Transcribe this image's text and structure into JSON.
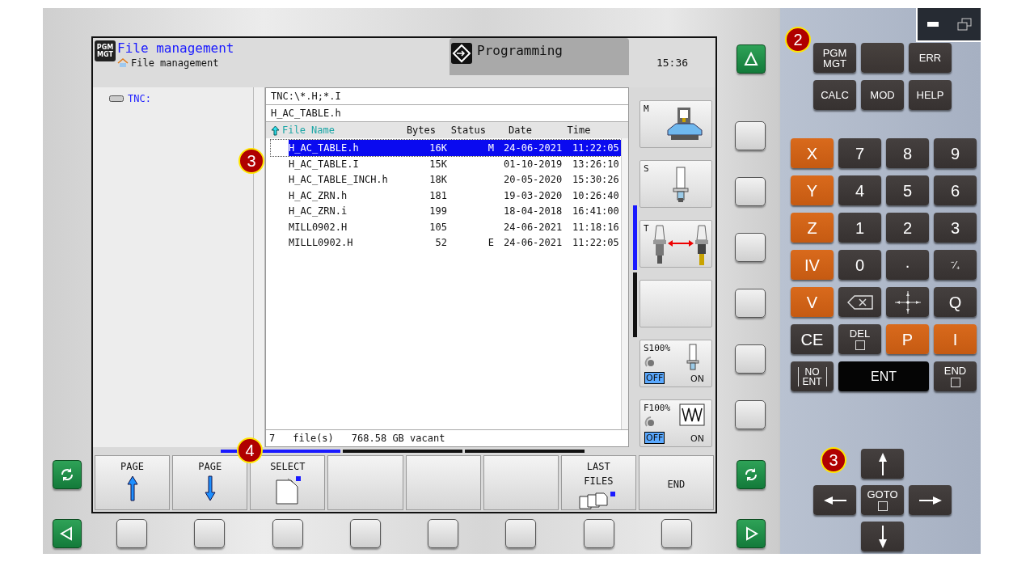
{
  "header": {
    "app_icon": "PGM MGT",
    "title": "File management",
    "breadcrumb": "File management",
    "mode_tab": "Programming",
    "clock": "15:36"
  },
  "tree": [
    {
      "label": "TNC:",
      "selected": false
    }
  ],
  "file_filter": "TNC:\\*.H;*.I",
  "current_file": "H_AC_TABLE.h",
  "columns": [
    "File Name",
    "Bytes",
    "Status",
    "Date",
    "Time"
  ],
  "rows": [
    {
      "name": "H_AC_TABLE.h",
      "bytes": "16K",
      "status": "M",
      "date": "24-06-2021",
      "time": "11:22:05",
      "selected": true
    },
    {
      "name": "H_AC_TABLE.I",
      "bytes": "15K",
      "status": "",
      "date": "01-10-2019",
      "time": "13:26:10",
      "selected": false
    },
    {
      "name": "H_AC_TABLE_INCH.h",
      "bytes": "18K",
      "status": "",
      "date": "20-05-2020",
      "time": "15:30:26",
      "selected": false
    },
    {
      "name": "H_AC_ZRN.h",
      "bytes": "181",
      "status": "",
      "date": "19-03-2020",
      "time": "10:26:40",
      "selected": false
    },
    {
      "name": "H_AC_ZRN.i",
      "bytes": "199",
      "status": "",
      "date": "18-04-2018",
      "time": "16:41:00",
      "selected": false
    },
    {
      "name": "MILL0902.H",
      "bytes": "105",
      "status": "",
      "date": "24-06-2021",
      "time": "11:18:16",
      "selected": false
    },
    {
      "name": "MILLL0902.H",
      "bytes": "52",
      "status": "E",
      "date": "24-06-2021",
      "time": "11:22:05",
      "selected": false
    }
  ],
  "rows_callout": "3",
  "status_bar": {
    "count": "7",
    "unit": "file(s)",
    "free": "768.58 GB vacant"
  },
  "side_softkeys": [
    {
      "kind": "machine",
      "label": "M"
    },
    {
      "kind": "spindle",
      "label": "S"
    },
    {
      "kind": "tool-change",
      "label": "T"
    },
    {
      "kind": "blank"
    },
    {
      "kind": "spindle-override",
      "label": "S100%",
      "off": "OFF",
      "on": "ON"
    },
    {
      "kind": "feed-override",
      "label": "F100%",
      "off": "OFF",
      "on": "ON"
    }
  ],
  "softkey_pages": [
    {
      "selected": true
    },
    {
      "selected": false
    },
    {
      "selected": false
    }
  ],
  "softkeys_callout": "4",
  "softkeys": [
    {
      "kind": "page-up",
      "label": "PAGE"
    },
    {
      "kind": "page-down",
      "label": "PAGE"
    },
    {
      "kind": "select",
      "label": "SELECT"
    },
    {
      "kind": "blank"
    },
    {
      "kind": "blank"
    },
    {
      "kind": "blank"
    },
    {
      "kind": "last-files",
      "label": "LAST FILES"
    },
    {
      "kind": "text",
      "label": "END"
    }
  ],
  "keypad_callout": "2",
  "function_keys": [
    {
      "kind": "text",
      "label": "PGM MGT"
    },
    {
      "kind": "blank"
    },
    {
      "kind": "text",
      "label": "ERR"
    },
    {
      "kind": "text",
      "label": "CALC"
    },
    {
      "kind": "text",
      "label": "MOD"
    },
    {
      "kind": "text",
      "label": "HELP"
    }
  ],
  "keypad": [
    {
      "kind": "axis",
      "label": "X"
    },
    {
      "kind": "text",
      "label": "7"
    },
    {
      "kind": "text",
      "label": "8"
    },
    {
      "kind": "text",
      "label": "9"
    },
    {
      "kind": "axis",
      "label": "Y"
    },
    {
      "kind": "text",
      "label": "4"
    },
    {
      "kind": "text",
      "label": "5"
    },
    {
      "kind": "text",
      "label": "6"
    },
    {
      "kind": "axis",
      "label": "Z"
    },
    {
      "kind": "text",
      "label": "1"
    },
    {
      "kind": "text",
      "label": "2"
    },
    {
      "kind": "text",
      "label": "3"
    },
    {
      "kind": "axis",
      "label": "IV"
    },
    {
      "kind": "text",
      "label": "0"
    },
    {
      "kind": "text",
      "label": "·"
    },
    {
      "kind": "text",
      "label": "⁻∕₊"
    },
    {
      "kind": "axis",
      "label": "V"
    },
    {
      "kind": "backspace"
    },
    {
      "kind": "center"
    },
    {
      "kind": "text",
      "label": "Q"
    },
    {
      "kind": "text",
      "label": "CE"
    },
    {
      "kind": "boxed",
      "label": "DEL"
    },
    {
      "kind": "axis",
      "label": "P"
    },
    {
      "kind": "axis",
      "label": "I"
    },
    {
      "kind": "framed",
      "label": "NO ENT"
    },
    {
      "kind": "enter",
      "label": "ENT"
    },
    {
      "kind": "boxed",
      "label": "END"
    }
  ],
  "arrows_callout": "3",
  "arrow_keys": [
    {
      "kind": "up"
    },
    {
      "kind": "left"
    },
    {
      "kind": "boxed",
      "label": "GOTO"
    },
    {
      "kind": "right"
    },
    {
      "kind": "down"
    }
  ]
}
